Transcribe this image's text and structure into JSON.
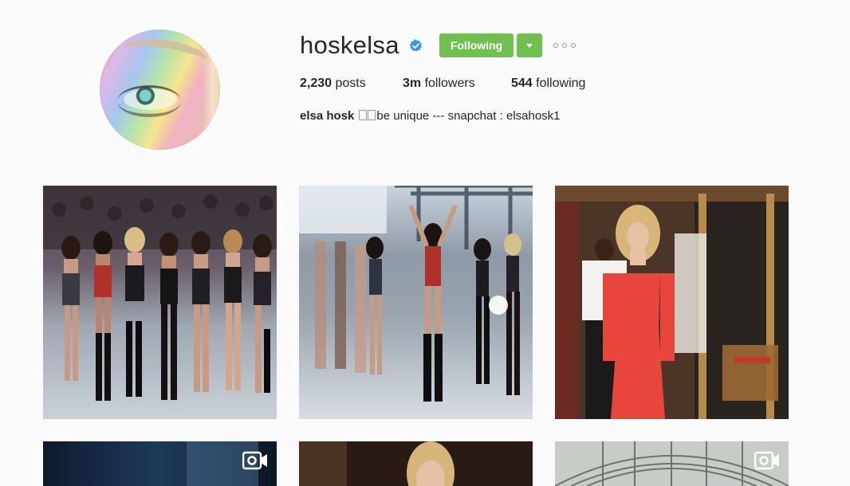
{
  "profile": {
    "username": "hoskelsa",
    "follow_button": "Following",
    "posts_count": "2,230",
    "posts_label": "posts",
    "followers_count": "3m",
    "followers_label": "followers",
    "following_count": "544",
    "following_label": "following",
    "bio_name": "elsa hosk",
    "bio_text": "be unique --- snapchat : elsahosk1"
  },
  "icons": {
    "verified": "verified-badge-icon",
    "dropdown": "chevron-down-icon",
    "more": "more-options-icon",
    "video": "video-camera-icon"
  },
  "colors": {
    "accent_green": "#70c050",
    "verified_blue": "#3897f0",
    "background": "#fafafa",
    "text": "#262626"
  }
}
